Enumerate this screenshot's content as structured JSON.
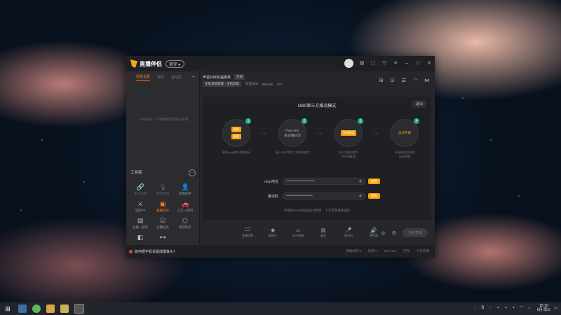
{
  "app": {
    "name": "直播伴侣",
    "badge": "测评 ▸"
  },
  "sidebar": {
    "tabs": [
      "场景设置",
      "素材",
      "互动区"
    ],
    "add": "+",
    "empty_hint": "OBS模式下 不需要配置场景与素材",
    "tools_title": "工具箱",
    "tools": [
      {
        "label": "多人连线",
        "icon": "🔗"
      },
      {
        "label": "语音连线",
        "icon": "🎙"
      },
      {
        "label": "房管助手",
        "icon": "👤"
      },
      {
        "label": "全民PK",
        "icon": "⚔"
      },
      {
        "label": "直播高光",
        "icon": "▣"
      },
      {
        "label": "上车一起玩",
        "icon": "🚗"
      },
      {
        "label": "主播一起玩",
        "icon": "▤"
      },
      {
        "label": "主播任务",
        "icon": "☑"
      },
      {
        "label": "发货助手",
        "icon": "⬡"
      },
      {
        "label": "",
        "icon": "◧"
      },
      {
        "label": "",
        "icon": "👓"
      },
      {
        "label": "",
        "icon": ""
      }
    ]
  },
  "room": {
    "title": "声音好听的温柔男",
    "tag": "普通",
    "category": "主机其他游戏 · 主机其他",
    "fans_label": "抖音号ID",
    "fans_value": "964485",
    "hot_value": "371"
  },
  "obs_panel": {
    "title": "OBS第三方推流模式",
    "exit": "退出",
    "steps": [
      {
        "num": "1",
        "lines": [
          {
            "text": "复制",
            "type": "btn"
          },
          {
            "text": "复制",
            "type": "btn"
          }
        ],
        "desc": "复制rtmp地址和推流码"
      },
      {
        "num": "2",
        "lines": [
          {
            "text": "FMS URL",
            "type": "text"
          },
          {
            "text": "串流/推码流",
            "type": "text"
          }
        ],
        "desc": "填入OBS等第三方推流软件"
      },
      {
        "num": "3",
        "lines": [
          {
            "text": "开始推流",
            "type": "btn"
          }
        ],
        "desc": "在三方推流软件\n中开始推流"
      },
      {
        "num": "4",
        "lines": [
          {
            "text": "自动开播",
            "type": "otext"
          }
        ],
        "desc": "开始推流后系统\n自动开播"
      }
    ],
    "rtmp_label": "rtmp地址",
    "rtmp_value": "••••••••••••••••••••••••••••",
    "key_label": "推流码",
    "key_value": "••••••••••••••••••••••••••",
    "copy_label": "复制",
    "hint": "开播后rtmp地址会自动更新，下次无需重复操作"
  },
  "bottom_bar": {
    "tools": [
      {
        "label": "直播设置",
        "icon": "🖵"
      },
      {
        "label": "摄像头",
        "icon": "◉"
      },
      {
        "label": "关注直播",
        "icon": "▭"
      },
      {
        "label": "美化",
        "icon": "▧"
      },
      {
        "label": "麦克风",
        "icon": "🎤"
      },
      {
        "label": "扬声器",
        "icon": "🔊"
      }
    ],
    "start_label": "开始直播"
  },
  "status": {
    "phone_text": "如何把手机设置成摄像头？",
    "stats": [
      "采集帧率 0",
      "码率 0",
      "CPU 0%",
      "内存",
      "声音检测"
    ]
  },
  "taskbar": {
    "time": "15:10",
    "date": "6月 周三"
  },
  "colors": {
    "accent": "#f5a30f",
    "step_num": "#2aa886"
  }
}
